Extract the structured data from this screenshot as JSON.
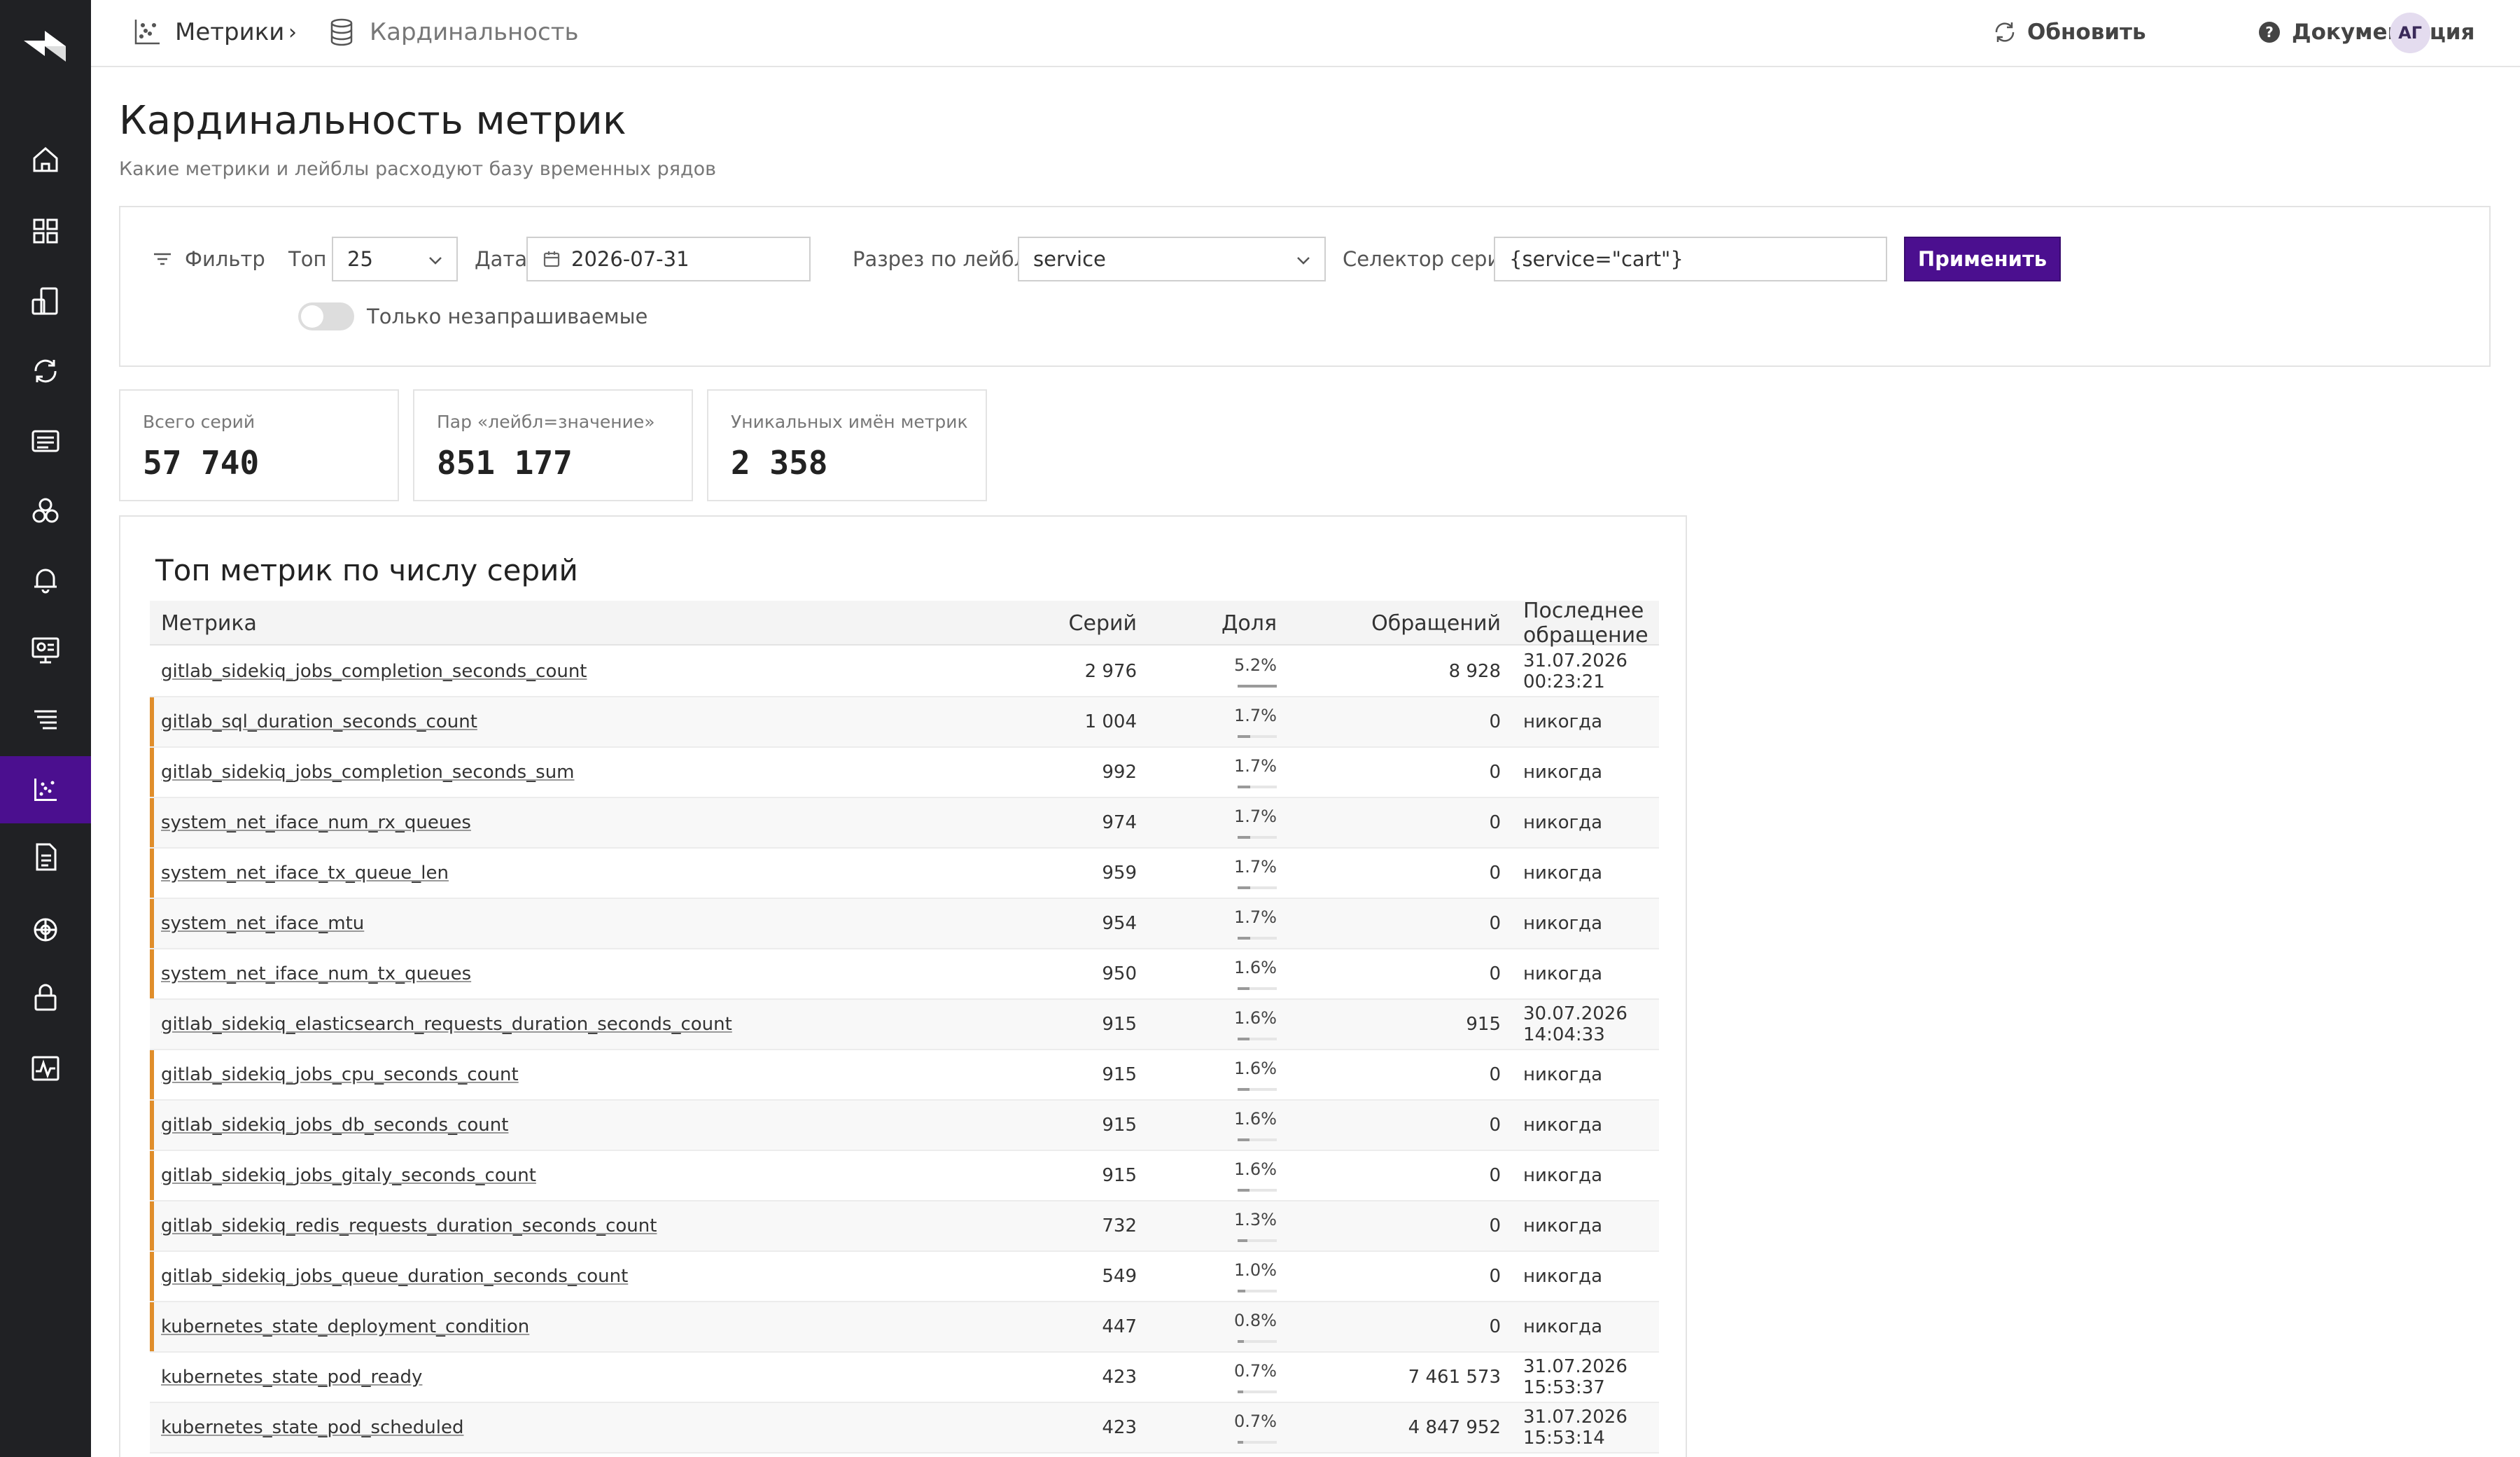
{
  "header": {
    "breadcrumb": [
      {
        "label": "Метрики",
        "icon": "scatter-chart-icon"
      },
      {
        "label": "Кардинальность",
        "icon": "database-icon"
      }
    ],
    "breadcrumb_separator": "›",
    "refresh_label": "Обновить",
    "docs_label": "Документация",
    "avatar_initials": "АГ"
  },
  "page": {
    "title": "Кардинальность метрик",
    "subtitle": "Какие метрики и лейблы расходуют базу временных рядов"
  },
  "filter": {
    "filter_label": "Фильтр",
    "top_label": "Топ",
    "top_value": "25",
    "date_label": "Дата",
    "date_value": "2026-07-31",
    "split_label": "Разрез по лейблу",
    "split_value": "service",
    "selector_label": "Селектор серий",
    "selector_value": "{service=\"cart\"}",
    "apply_label": "Применить",
    "only_unqueried_label": "Только незапрашиваемые",
    "only_unqueried_on": false
  },
  "stats": [
    {
      "label": "Всего серий",
      "value": "57 740"
    },
    {
      "label": "Пар «лейбл=значение»",
      "value": "851 177"
    },
    {
      "label": "Уникальных имён метрик",
      "value": "2 358"
    }
  ],
  "table": {
    "title": "Топ метрик по числу серий",
    "columns": {
      "metric": "Метрика",
      "series": "Серий",
      "share": "Доля",
      "requests": "Обращений",
      "last_access": "Последнее обращение"
    },
    "rows": [
      {
        "metric": "gitlab_sidekiq_jobs_completion_seconds_count",
        "series": "2 976",
        "share": "5.2%",
        "share_pct": 5.2,
        "requests": "8 928",
        "last_access": "31.07.2026 00:23:21",
        "unused": false
      },
      {
        "metric": "gitlab_sql_duration_seconds_count",
        "series": "1 004",
        "share": "1.7%",
        "share_pct": 1.7,
        "requests": "0",
        "last_access": "никогда",
        "unused": true
      },
      {
        "metric": "gitlab_sidekiq_jobs_completion_seconds_sum",
        "series": "992",
        "share": "1.7%",
        "share_pct": 1.7,
        "requests": "0",
        "last_access": "никогда",
        "unused": true
      },
      {
        "metric": "system_net_iface_num_rx_queues",
        "series": "974",
        "share": "1.7%",
        "share_pct": 1.7,
        "requests": "0",
        "last_access": "никогда",
        "unused": true
      },
      {
        "metric": "system_net_iface_tx_queue_len",
        "series": "959",
        "share": "1.7%",
        "share_pct": 1.7,
        "requests": "0",
        "last_access": "никогда",
        "unused": true
      },
      {
        "metric": "system_net_iface_mtu",
        "series": "954",
        "share": "1.7%",
        "share_pct": 1.7,
        "requests": "0",
        "last_access": "никогда",
        "unused": true
      },
      {
        "metric": "system_net_iface_num_tx_queues",
        "series": "950",
        "share": "1.6%",
        "share_pct": 1.6,
        "requests": "0",
        "last_access": "никогда",
        "unused": true
      },
      {
        "metric": "gitlab_sidekiq_elasticsearch_requests_duration_seconds_count",
        "series": "915",
        "share": "1.6%",
        "share_pct": 1.6,
        "requests": "915",
        "last_access": "30.07.2026 14:04:33",
        "unused": false
      },
      {
        "metric": "gitlab_sidekiq_jobs_cpu_seconds_count",
        "series": "915",
        "share": "1.6%",
        "share_pct": 1.6,
        "requests": "0",
        "last_access": "никогда",
        "unused": true
      },
      {
        "metric": "gitlab_sidekiq_jobs_db_seconds_count",
        "series": "915",
        "share": "1.6%",
        "share_pct": 1.6,
        "requests": "0",
        "last_access": "никогда",
        "unused": true
      },
      {
        "metric": "gitlab_sidekiq_jobs_gitaly_seconds_count",
        "series": "915",
        "share": "1.6%",
        "share_pct": 1.6,
        "requests": "0",
        "last_access": "никогда",
        "unused": true
      },
      {
        "metric": "gitlab_sidekiq_redis_requests_duration_seconds_count",
        "series": "732",
        "share": "1.3%",
        "share_pct": 1.3,
        "requests": "0",
        "last_access": "никогда",
        "unused": true
      },
      {
        "metric": "gitlab_sidekiq_jobs_queue_duration_seconds_count",
        "series": "549",
        "share": "1.0%",
        "share_pct": 1.0,
        "requests": "0",
        "last_access": "никогда",
        "unused": true
      },
      {
        "metric": "kubernetes_state_deployment_condition",
        "series": "447",
        "share": "0.8%",
        "share_pct": 0.8,
        "requests": "0",
        "last_access": "никогда",
        "unused": true
      },
      {
        "metric": "kubernetes_state_pod_ready",
        "series": "423",
        "share": "0.7%",
        "share_pct": 0.7,
        "requests": "7 461 573",
        "last_access": "31.07.2026 15:53:37",
        "unused": false
      },
      {
        "metric": "kubernetes_state_pod_scheduled",
        "series": "423",
        "share": "0.7%",
        "share_pct": 0.7,
        "requests": "4 847 952",
        "last_access": "31.07.2026 15:53:14",
        "unused": false
      }
    ]
  },
  "colors": {
    "sidebar_bg": "#202124",
    "accent": "#4b0f8f",
    "unused_marker": "#e08e2b"
  },
  "sidebar": {
    "items": [
      {
        "icon": "home-icon"
      },
      {
        "icon": "dashboards-icon"
      },
      {
        "icon": "devices-icon"
      },
      {
        "icon": "sync-icon"
      },
      {
        "icon": "list-icon"
      },
      {
        "icon": "services-icon"
      },
      {
        "icon": "bell-icon"
      },
      {
        "icon": "monitor-icon"
      },
      {
        "icon": "layers-icon"
      },
      {
        "icon": "metrics-icon",
        "active": true
      },
      {
        "icon": "document-icon"
      },
      {
        "icon": "brain-icon"
      },
      {
        "icon": "lock-icon"
      },
      {
        "icon": "activity-icon"
      }
    ]
  }
}
